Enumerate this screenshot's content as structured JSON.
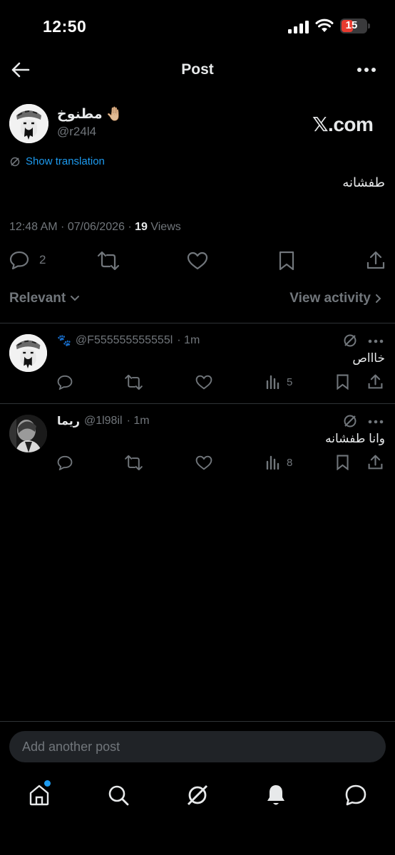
{
  "status_bar": {
    "time": "12:50",
    "battery": "15"
  },
  "header": {
    "title": "Post"
  },
  "post": {
    "author_name": "مطنوخ 🤚🏼",
    "author_handle": "@r24l4",
    "brand": "𝕏.com",
    "show_translation": "Show translation",
    "text": "طفشانه",
    "timestamp": "12:48 AM · 07/06/2026 · ",
    "views_count": "19",
    "views_label": " Views",
    "actions": {
      "replies": "2"
    }
  },
  "replies_header": {
    "sort_label": "Relevant",
    "view_activity": "View activity"
  },
  "replies": [
    {
      "name": "🐾",
      "handle": "@F555555555555l",
      "time": "· 1m",
      "text": "خاااص",
      "views": "5"
    },
    {
      "name": "ريما",
      "handle": "@1l98il",
      "time": "· 1m",
      "text": "وانا طفشانه",
      "views": "8"
    }
  ],
  "composer": {
    "placeholder": "Add another post"
  },
  "tab_bar": {
    "items": [
      "home",
      "search",
      "grok",
      "notifications",
      "messages"
    ]
  },
  "colors": {
    "accent": "#1d9bf0",
    "background": "#000000",
    "muted": "#71767b",
    "text": "#e7e9ea",
    "battery_low": "#e83b30"
  }
}
